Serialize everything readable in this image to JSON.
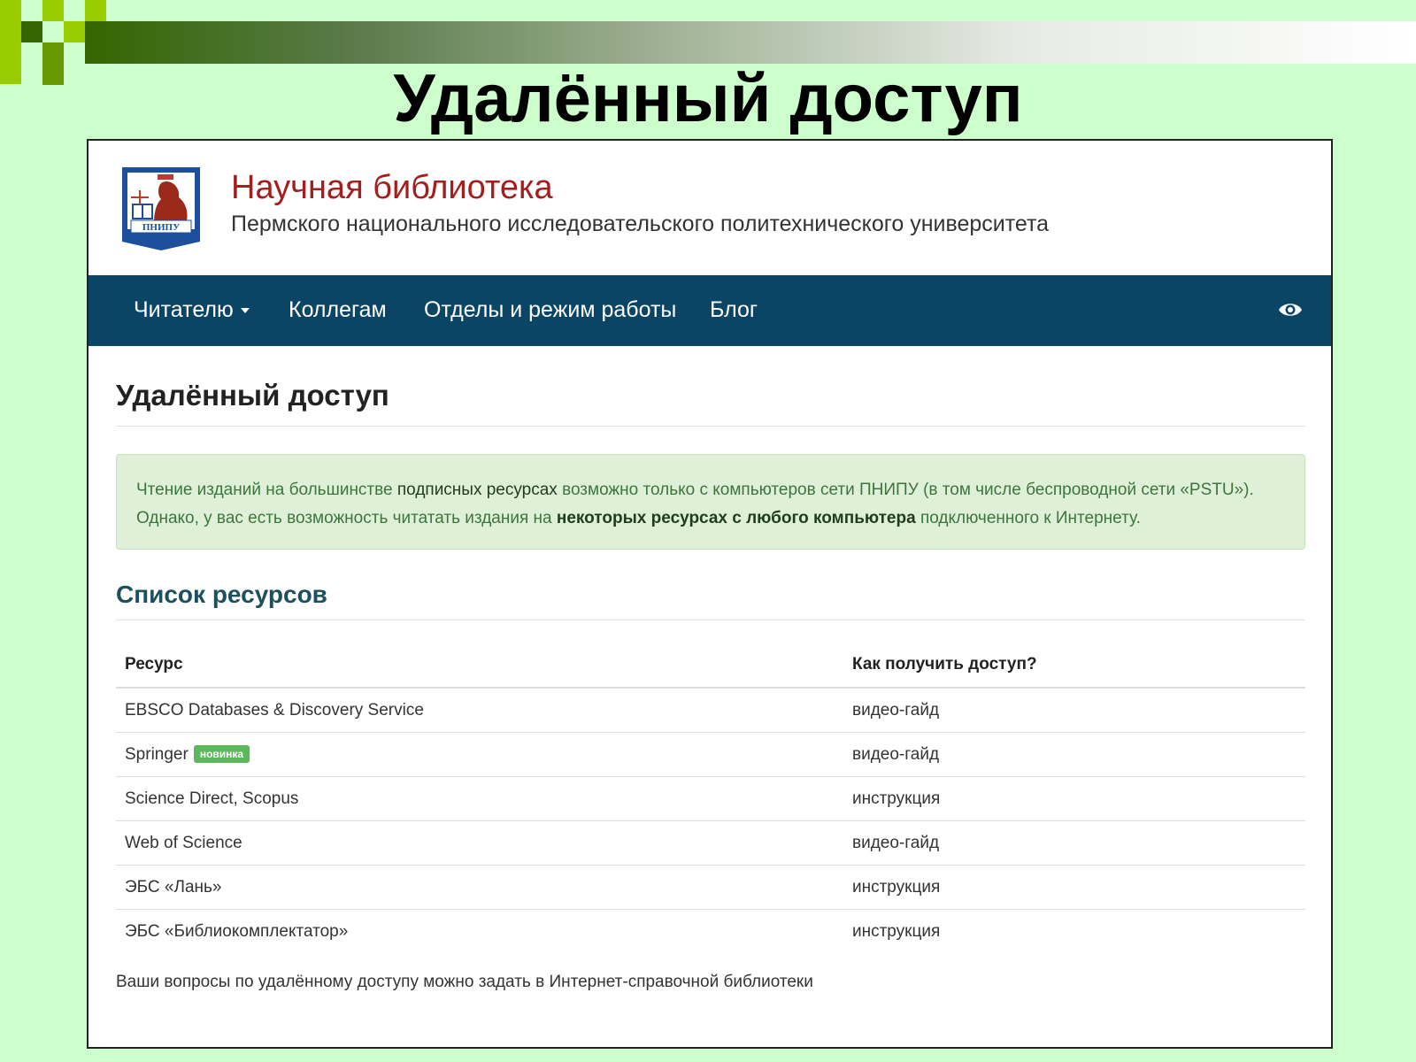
{
  "slide": {
    "title": "Удалённый доступ"
  },
  "site": {
    "logo_text": "ПНИПУ",
    "name": "Научная библиотека",
    "subtitle": "Пермского национального исследовательского политехнического университета"
  },
  "nav": {
    "items": [
      {
        "label": "Читателю",
        "has_caret": true
      },
      {
        "label": "Коллегам"
      },
      {
        "label": "Отделы и режим работы"
      },
      {
        "label": "Блог"
      }
    ],
    "accessibility_icon": "eye-icon"
  },
  "page": {
    "heading": "Удалённый доступ",
    "alert": {
      "part1": "Чтение изданий на большинстве ",
      "part2": "подписных ресурсах",
      "part3": " возможно только с компьютеров сети ПНИПУ (в том числе беспроводной сети «PSTU»).",
      "part4": "Однако, у вас есть возможность читатать издания на ",
      "part5": "некоторых ресурсах с любого компьютера",
      "part6": " подключенного к Интернету."
    },
    "list_heading": "Список ресурсов",
    "table": {
      "headers": [
        "Ресурс",
        "Как получить доступ?"
      ],
      "rows": [
        {
          "resource": "EBSCO Databases & Discovery Service",
          "access": "видео-гайд"
        },
        {
          "resource": "Springer",
          "badge": "новинка",
          "access": "видео-гайд"
        },
        {
          "resource": "Science Direct, Scopus",
          "access": "инструкция"
        },
        {
          "resource": "Web of Science",
          "access": "видео-гайд"
        },
        {
          "resource": "ЭБС «Лань»",
          "access": "инструкция"
        },
        {
          "resource": "ЭБС «Библиокомплектатор»",
          "access": "инструкция"
        }
      ]
    },
    "footer_note": "Ваши вопросы по удалённому доступу можно задать в Интернет-справочной библиотеки"
  },
  "colors": {
    "slide_bg": "#ccffcc",
    "navbar": "#0b4566",
    "library_name": "#a31f1f",
    "alert_bg": "#dff0d8",
    "badge": "#5cb85c"
  }
}
